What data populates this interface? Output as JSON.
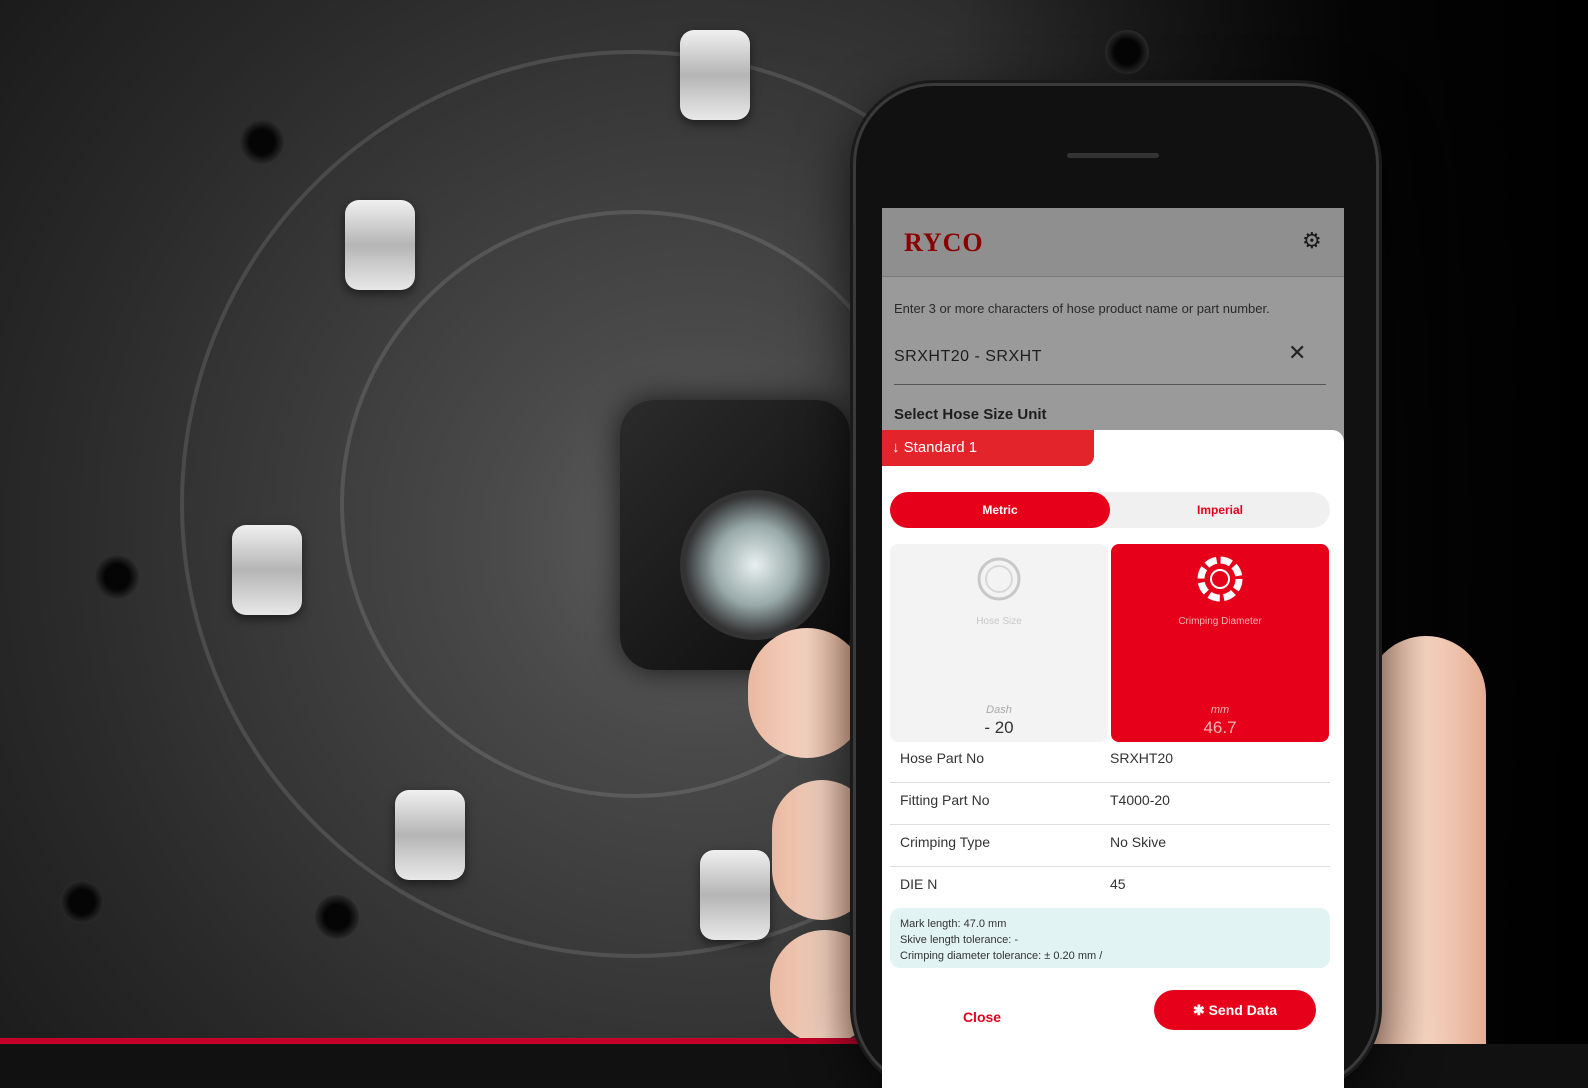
{
  "app": {
    "logo_text": "RYCO",
    "settings_icon": "gear-icon"
  },
  "search": {
    "hint": "Enter 3 or more characters of hose product name or part number.",
    "value": "SRXHT20 - SRXHT"
  },
  "hose_size": {
    "section_title": "Select Hose Size Unit",
    "standard_label": "Standard 1",
    "toggle": {
      "metric_label": "Metric",
      "imperial_label": "Imperial",
      "selected": "Metric"
    },
    "cards": {
      "hose_size": {
        "label": "Hose Size",
        "unit": "Dash",
        "value": "- 20",
        "selected": false
      },
      "crimping_diameter": {
        "label": "Crimping Diameter",
        "unit": "mm",
        "value": "46.7",
        "selected": true
      }
    }
  },
  "details": [
    {
      "label": "Hose Part No",
      "value": "SRXHT20"
    },
    {
      "label": "Fitting Part No",
      "value": "T4000-20"
    },
    {
      "label": "Crimping Type",
      "value": "No Skive"
    },
    {
      "label": "DIE N",
      "value": "45"
    }
  ],
  "note": {
    "mark_length": "Mark length: 47.0 mm",
    "skive_tolerance": "Skive length tolerance: -",
    "crimp_tolerance": "Crimping diameter tolerance: ± 0.20 mm /"
  },
  "actions": {
    "close_label": "Close",
    "send_label": "Send Data"
  },
  "colors": {
    "brand_red": "#e6001a",
    "note_bg": "#e2f3f4"
  }
}
